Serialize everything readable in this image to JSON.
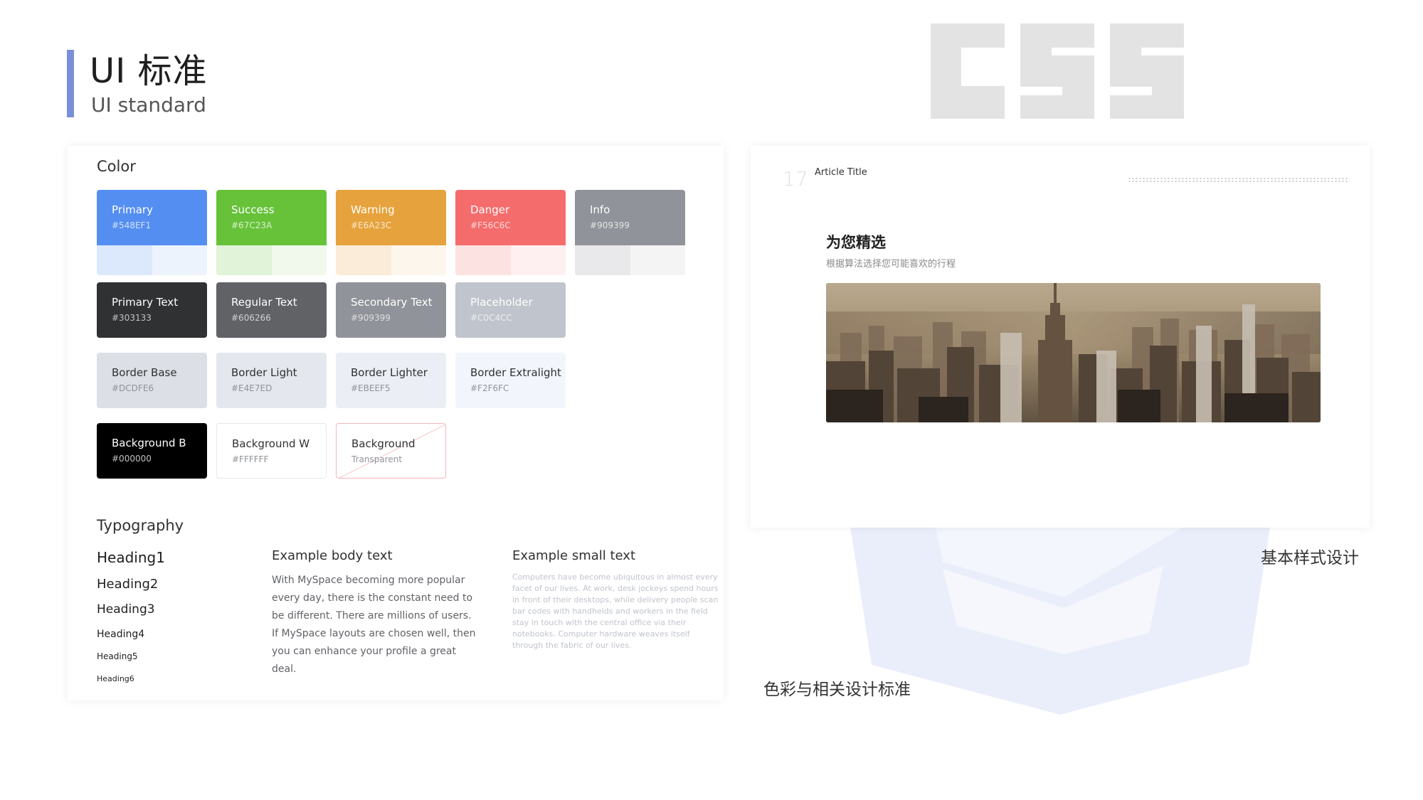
{
  "header": {
    "title": "UI 标准",
    "subtitle": "UI standard"
  },
  "captions": {
    "right": "基本样式设计",
    "left": "色彩与相关设计标准"
  },
  "colors_section": {
    "title": "Color",
    "brand": [
      {
        "name": "Primary",
        "hex": "#548EF1",
        "color": "#548ef1",
        "tint1": "#dce8fc",
        "tint2": "#edf3fd"
      },
      {
        "name": "Success",
        "hex": "#67C23A",
        "color": "#67c23a",
        "tint1": "#e1f3d8",
        "tint2": "#f0f9eb"
      },
      {
        "name": "Warning",
        "hex": "#E6A23C",
        "color": "#e6a23c",
        "tint1": "#faecd8",
        "tint2": "#fdf6ec"
      },
      {
        "name": "Danger",
        "hex": "#F56C6C",
        "color": "#f56c6c",
        "tint1": "#fde2e2",
        "tint2": "#fef0f0"
      },
      {
        "name": "Info",
        "hex": "#909399",
        "color": "#909399",
        "tint1": "#e9e9eb",
        "tint2": "#f4f4f5"
      }
    ],
    "text": [
      {
        "name": "Primary Text",
        "hex": "#303133",
        "color": "#303133"
      },
      {
        "name": "Regular Text",
        "hex": "#606266",
        "color": "#606266"
      },
      {
        "name": "Secondary Text",
        "hex": "#909399",
        "color": "#909399"
      },
      {
        "name": "Placeholder",
        "hex": "#C0C4CC",
        "color": "#c0c4cc"
      }
    ],
    "border": [
      {
        "name": "Border Base",
        "hex": "#DCDFE6",
        "color": "#dcdfe6"
      },
      {
        "name": "Border Light",
        "hex": "#E4E7ED",
        "color": "#e4e7ed"
      },
      {
        "name": "Border Lighter",
        "hex": "#EBEEF5",
        "color": "#ebeef5"
      },
      {
        "name": "Border Extralight",
        "hex": "#F2F6FC",
        "color": "#f2f6fc"
      }
    ],
    "background": [
      {
        "name": "Background B",
        "hex": "#000000",
        "color": "#000000"
      },
      {
        "name": "Background W",
        "hex": "#FFFFFF",
        "color": "#ffffff"
      },
      {
        "name": "Background",
        "hex": "Transparent",
        "color": "transparent"
      }
    ]
  },
  "typography": {
    "title": "Typography",
    "headings": [
      "Heading1",
      "Heading2",
      "Heading3",
      "Heading4",
      "Heading5",
      "Heading6"
    ],
    "body_title": "Example body text",
    "body_text": "With MySpace becoming more popular every day, there is the constant need to be different. There are millions of users. If MySpace layouts are chosen well, then you can enhance your profile a great deal.",
    "small_title": "Example small text",
    "small_text": "Computers have become ubiquitous in almost every facet of our lives. At work, desk jockeys spend hours in front of their desktops, while delivery people scan bar codes with handhelds and workers in the field stay in touch with the central office via their notebooks. Computer hardware weaves itself through the fabric of our lives."
  },
  "article": {
    "number": "17",
    "title": "Article Title",
    "feature_title": "为您精选",
    "feature_subtitle": "根据算法选择您可能喜欢的行程"
  }
}
